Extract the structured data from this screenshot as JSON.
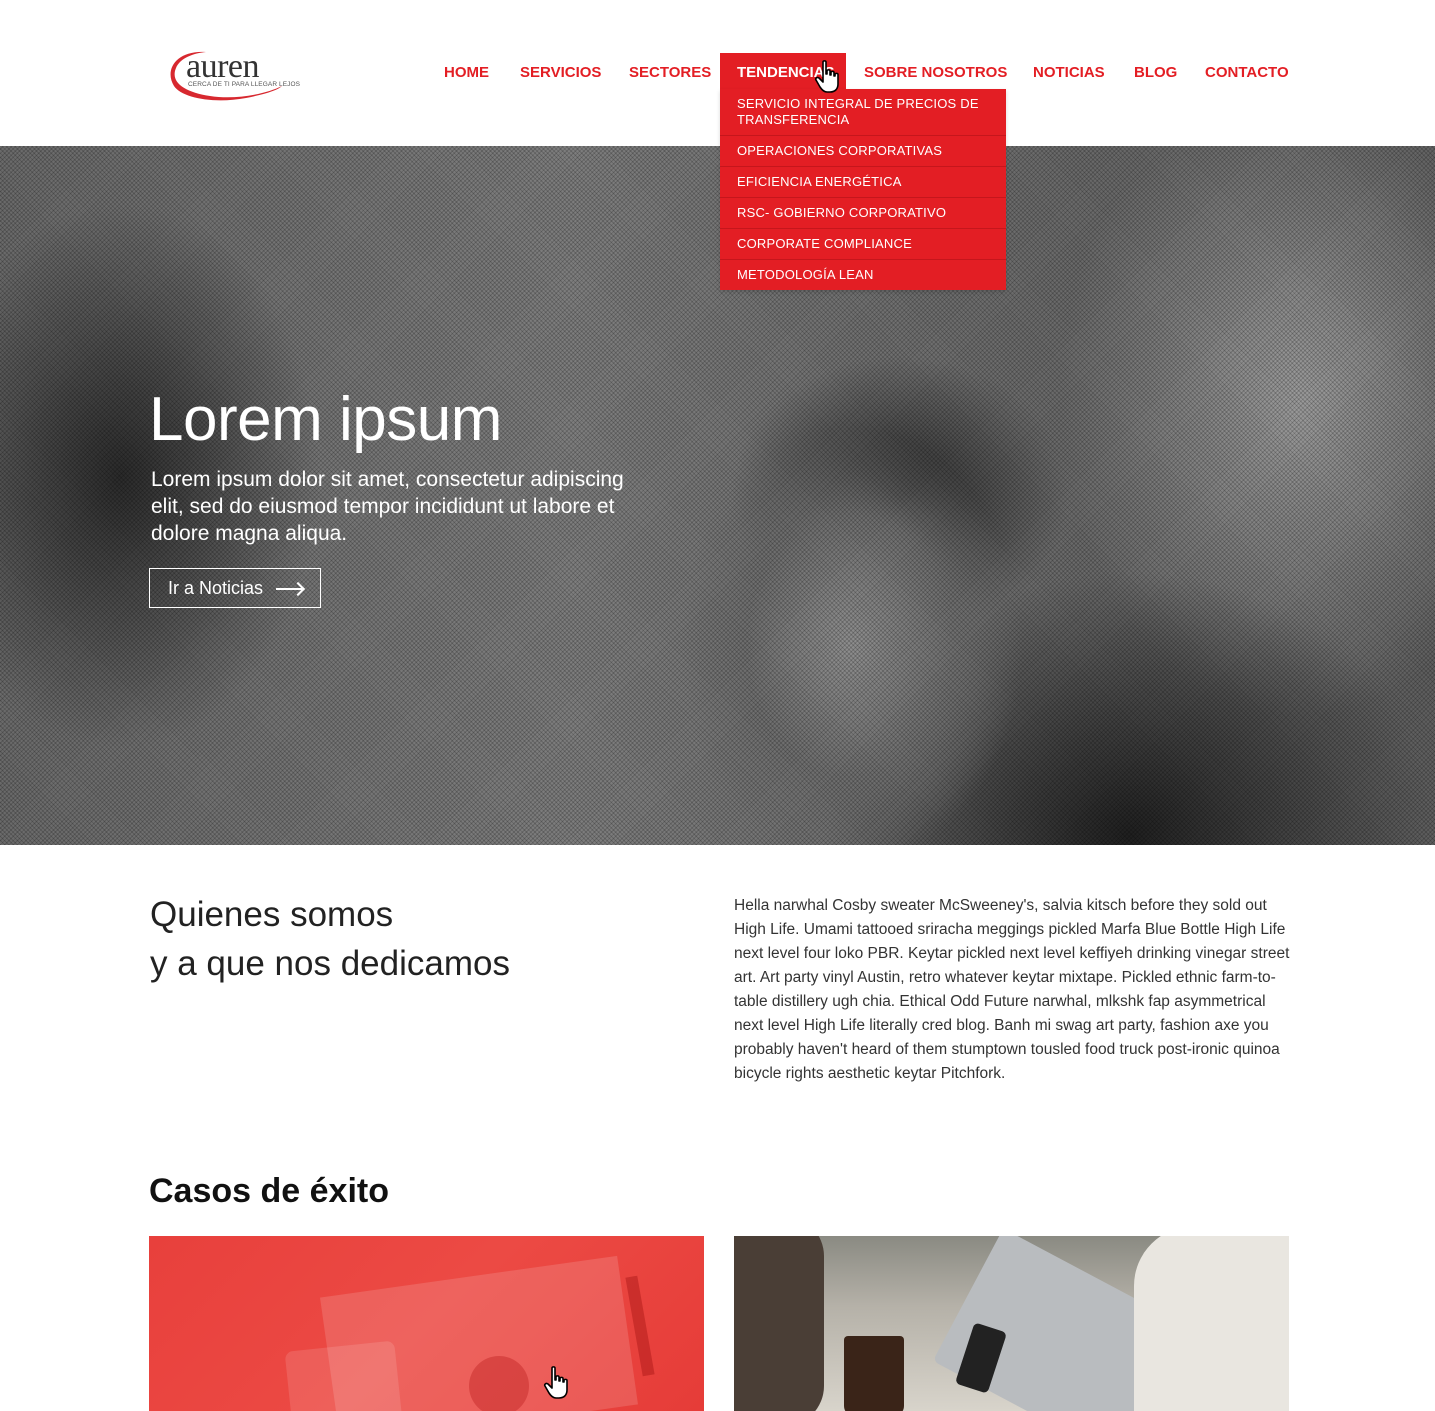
{
  "brand": {
    "name": "auren",
    "tagline": "CERCA DE TI PARA LLEGAR LEJOS",
    "primary_color": "#e31e24"
  },
  "nav": {
    "items": [
      {
        "label": "HOME"
      },
      {
        "label": "SERVICIOS"
      },
      {
        "label": "SECTORES"
      },
      {
        "label": "TENDENCIAS",
        "active": true
      },
      {
        "label": "SOBRE NOSOTROS"
      },
      {
        "label": "NOTICIAS"
      },
      {
        "label": "BLOG"
      },
      {
        "label": "CONTACTO"
      }
    ]
  },
  "dropdown": {
    "items": [
      "SERVICIO INTEGRAL DE PRECIOS DE TRANSFERENCIA",
      "OPERACIONES CORPORATIVAS",
      "EFICIENCIA ENERGÉTICA",
      "RSC- GOBIERNO CORPORATIVO",
      "CORPORATE COMPLIANCE",
      "METODOLOGÍA LEAN"
    ]
  },
  "hero": {
    "title": "Lorem ipsum",
    "text": "Lorem ipsum dolor sit amet, consectetur adipiscing elit, sed do eiusmod tempor incididunt ut labore et dolore magna aliqua.",
    "button_label": "Ir a Noticias"
  },
  "about": {
    "title_line1": "Quienes somos",
    "title_line2": "y a que nos dedicamos",
    "text": "Hella narwhal Cosby sweater McSweeney's, salvia kitsch before they sold out High Life. Umami tattooed sriracha meggings pickled Marfa Blue Bottle High Life next level four loko PBR. Keytar pickled next level keffiyeh drinking vinegar street art. Art party vinyl Austin, retro whatever keytar mixtape. Pickled ethnic farm-to-table distillery ugh chia. Ethical Odd Future narwhal, mlkshk fap asymmetrical next level High Life literally cred blog. Banh mi swag art party, fashion axe you probably haven't heard of them stumptown tousled food truck post-ironic quinoa bicycle rights aesthetic keytar Pitchfork."
  },
  "casos": {
    "title": "Casos de éxito"
  }
}
